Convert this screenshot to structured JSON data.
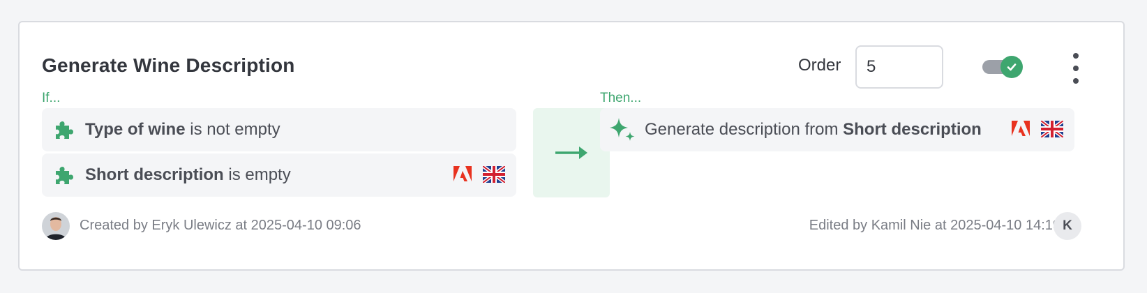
{
  "rule": {
    "title": "Generate Wine Description",
    "order_label": "Order",
    "order_value": "5",
    "enabled": true
  },
  "conditions": {
    "label": "If...",
    "items": [
      {
        "field": "Type of wine",
        "operator": "is not empty",
        "icon": "puzzle-icon",
        "flags": []
      },
      {
        "field": "Short description",
        "operator": "is empty",
        "icon": "puzzle-icon",
        "flags": [
          "adobe-icon",
          "uk-flag-icon"
        ]
      }
    ]
  },
  "actions": {
    "label": "Then...",
    "items": [
      {
        "text": "Generate description from",
        "field": "Short description",
        "icon": "sparkle-icon",
        "flags": [
          "adobe-icon",
          "uk-flag-icon"
        ]
      }
    ]
  },
  "footer": {
    "created": "Created by Eryk Ulewicz at 2025-04-10 09:06",
    "edited": "Edited by Kamil Nie at 2025-04-10 14:19",
    "editor_initial": "K"
  },
  "colors": {
    "accent": "#3ea66f",
    "arrow_bg": "#e9f6ee",
    "row_bg": "#f4f5f7",
    "card_border": "#d9dbe0"
  }
}
